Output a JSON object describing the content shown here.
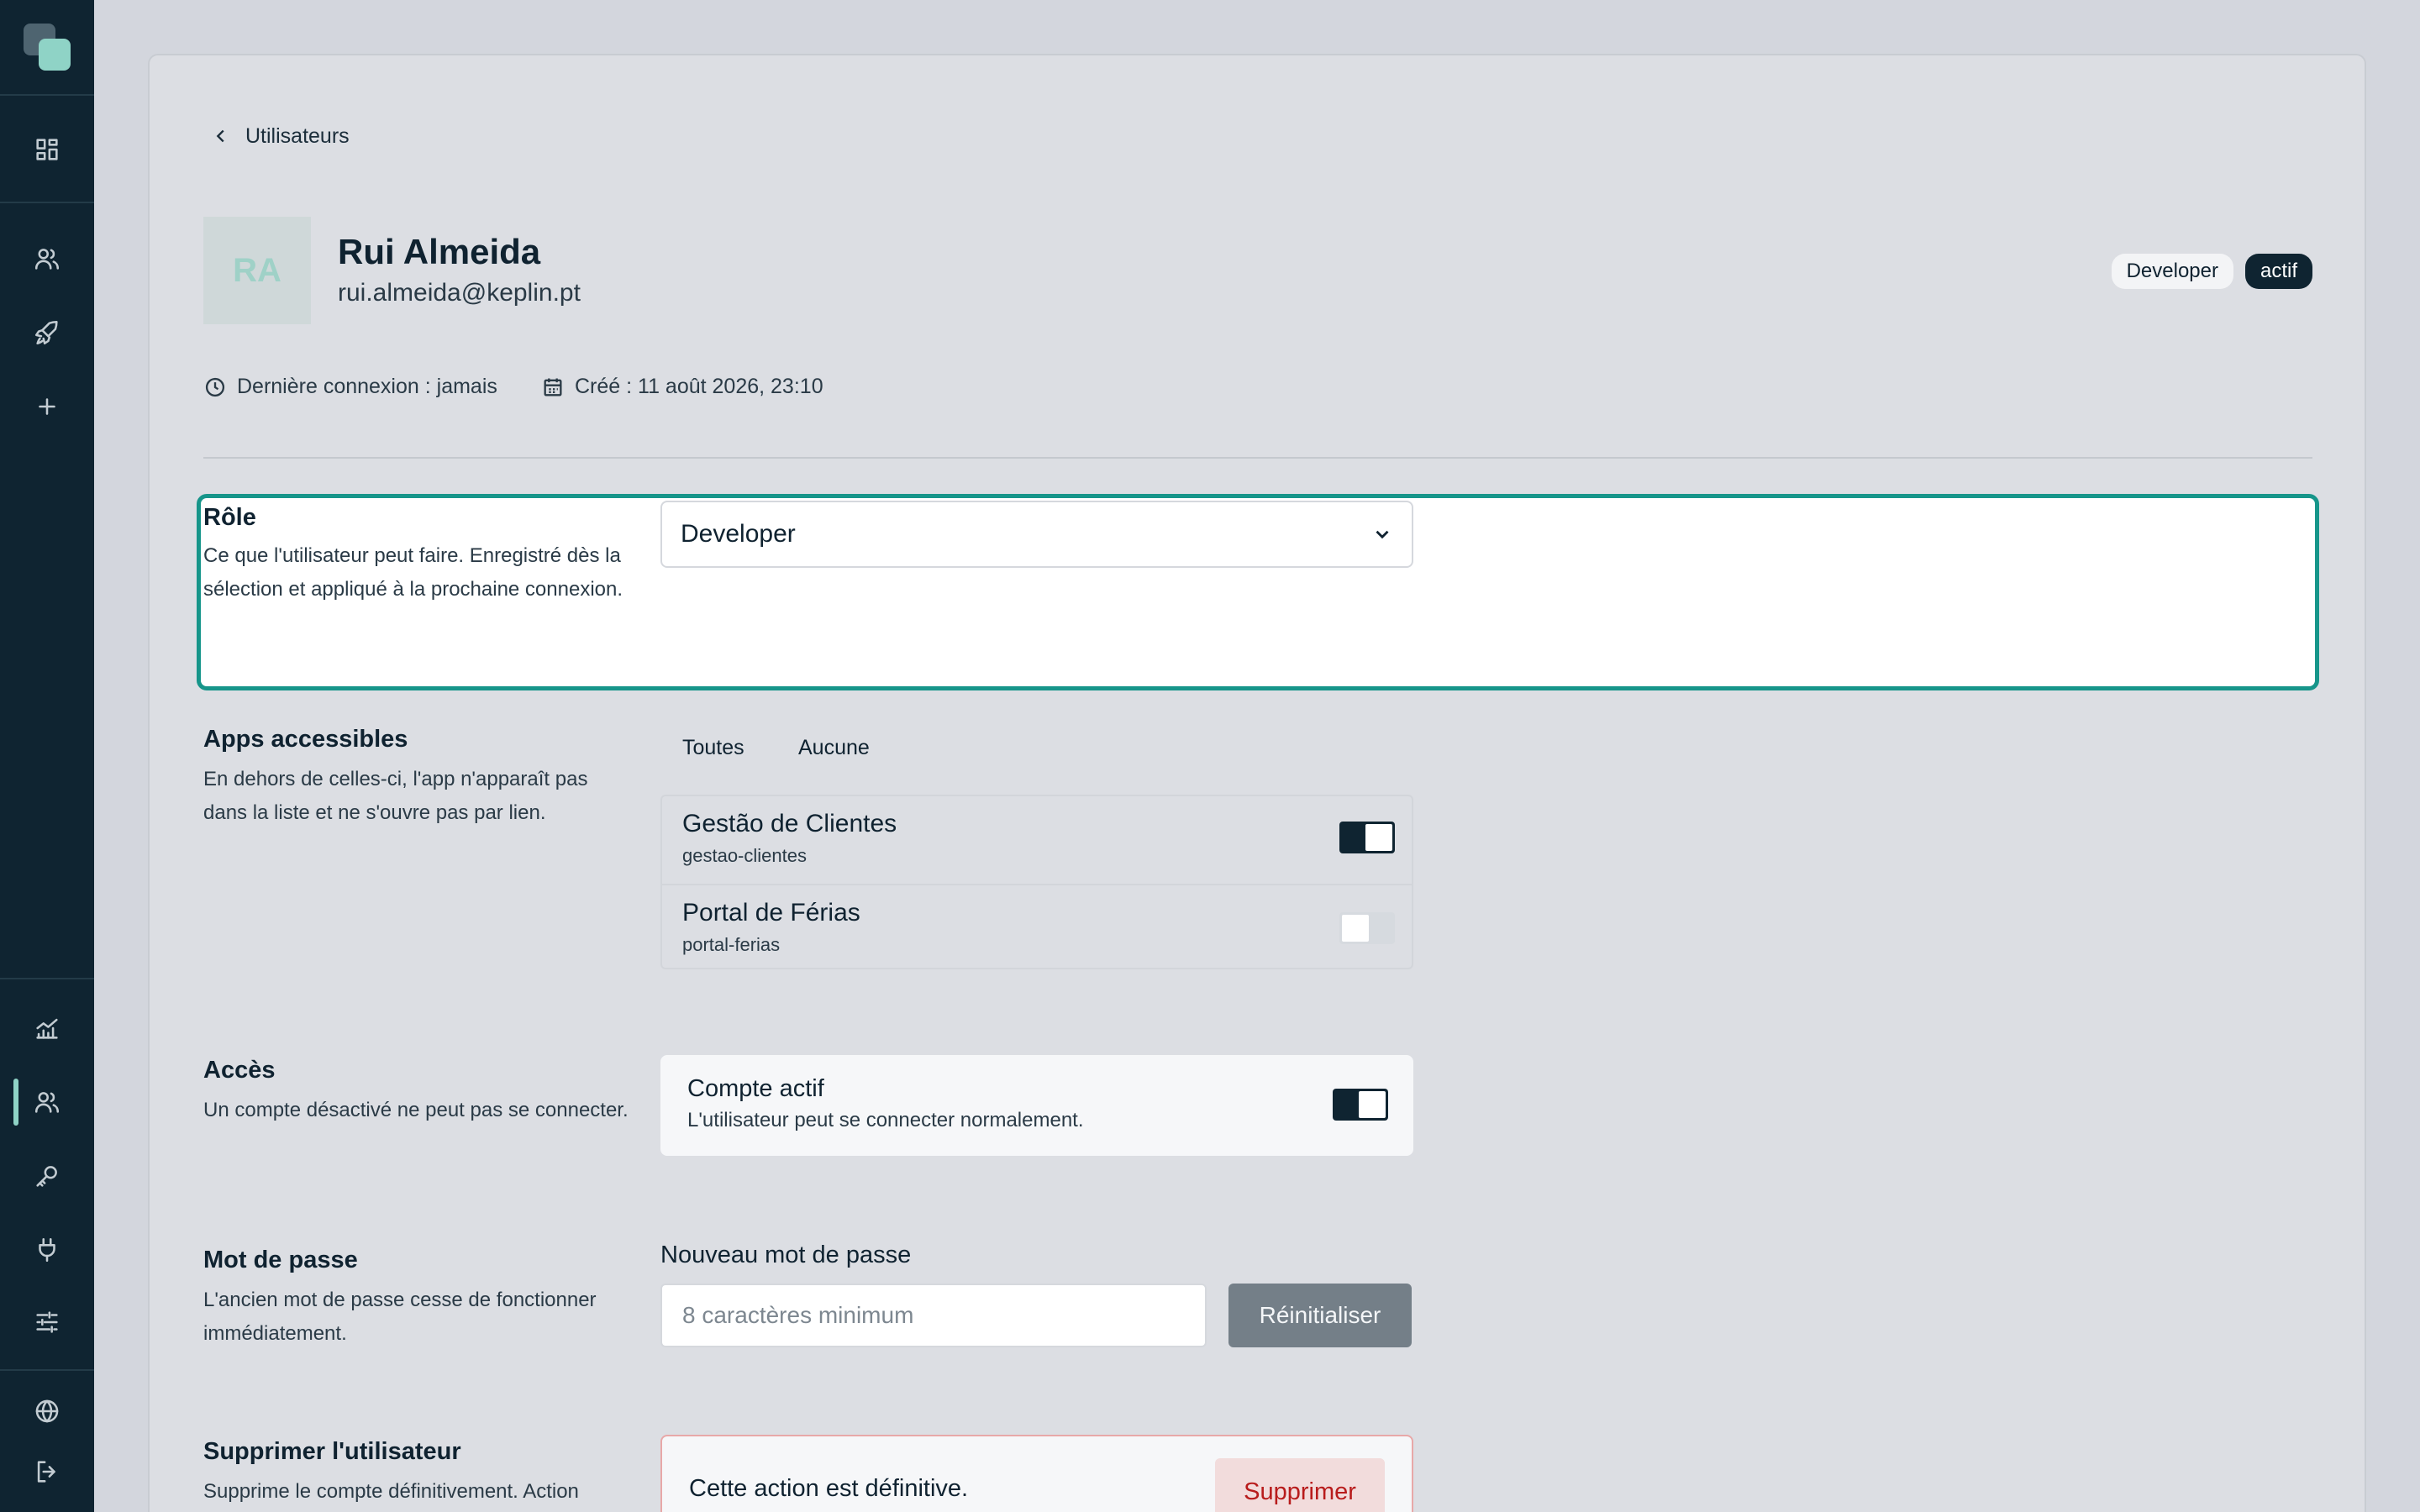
{
  "sidebar": {
    "icons": [
      "logo",
      "dashboard-icon",
      "users-icon",
      "rocket-icon",
      "plus-icon",
      "analytics-icon",
      "users-icon",
      "key-icon",
      "plug-icon",
      "sliders-icon",
      "globe-icon",
      "logout-icon"
    ],
    "active": "users"
  },
  "breadcrumb": {
    "back_label": "Utilisateurs"
  },
  "user": {
    "initials": "RA",
    "name": "Rui Almeida",
    "email": "rui.almeida@keplin.pt",
    "role_badge": "Developer",
    "status_badge": "actif",
    "last_login": "Dernière connexion : jamais",
    "created": "Créé : 11 août 2026, 23:10"
  },
  "role": {
    "title": "Rôle",
    "description": "Ce que l'utilisateur peut faire. Enregistré dès la sélection et appliqué à la prochaine connexion.",
    "selected": "Developer"
  },
  "apps": {
    "title": "Apps accessibles",
    "description": "En dehors de celles-ci, l'app n'apparaît pas dans la liste et ne s'ouvre pas par lien.",
    "select_all": "Toutes",
    "select_none": "Aucune",
    "items": [
      {
        "name": "Gestão de Clientes",
        "slug": "gestao-clientes",
        "enabled": true
      },
      {
        "name": "Portal de Férias",
        "slug": "portal-ferias",
        "enabled": false
      }
    ]
  },
  "access": {
    "title": "Accès",
    "description": "Un compte désactivé ne peut pas se connecter.",
    "card_title": "Compte actif",
    "card_desc": "L'utilisateur peut se connecter normalement.",
    "enabled": true
  },
  "password": {
    "title": "Mot de passe",
    "description": "L'ancien mot de passe cesse de fonctionner immédiatement.",
    "field_label": "Nouveau mot de passe",
    "placeholder": "8 caractères minimum",
    "button": "Réinitialiser"
  },
  "delete": {
    "title": "Supprimer l'utilisateur",
    "description": "Supprime le compte définitivement. Action",
    "warning": "Cette action est définitive.",
    "button": "Supprimer"
  },
  "colors": {
    "sidebar_bg": "#0f2431",
    "accent": "#16958a",
    "danger": "#b81c1c"
  }
}
